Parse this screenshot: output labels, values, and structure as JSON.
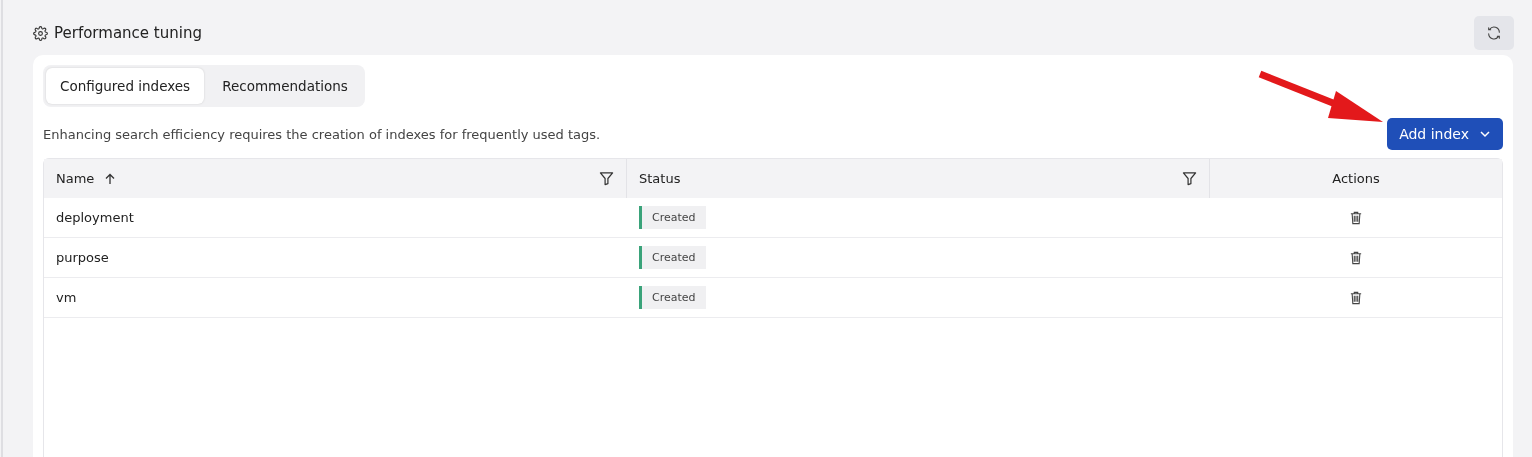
{
  "panel": {
    "title": "Performance tuning"
  },
  "tabs": [
    {
      "label": "Configured indexes",
      "selected": true
    },
    {
      "label": "Recommendations",
      "selected": false
    }
  ],
  "description": "Enhancing search efficiency requires the creation of indexes for frequently used tags.",
  "add_button": {
    "label": "Add index"
  },
  "table": {
    "columns": [
      {
        "label": "Name",
        "kind": "data",
        "sorted": true,
        "filterable": true
      },
      {
        "label": "Status",
        "kind": "data",
        "sorted": false,
        "filterable": true
      },
      {
        "label": "Actions",
        "kind": "actions",
        "sorted": false,
        "filterable": false
      }
    ],
    "rows": [
      {
        "name": "deployment",
        "status": "Created"
      },
      {
        "name": "purpose",
        "status": "Created"
      },
      {
        "name": "vm",
        "status": "Created"
      }
    ]
  }
}
